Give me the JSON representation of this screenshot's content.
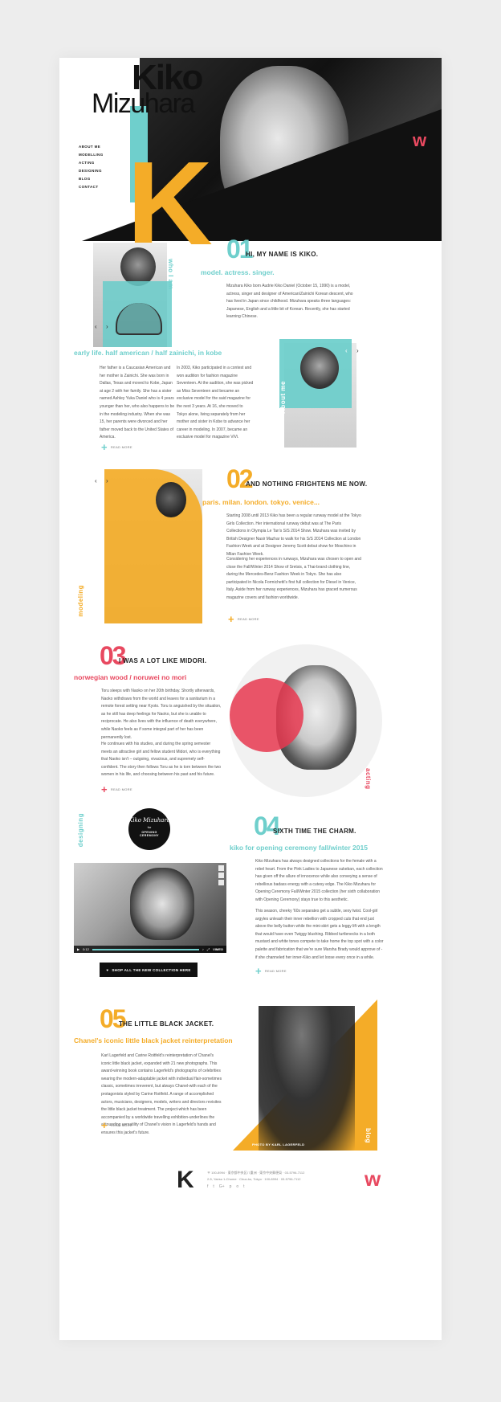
{
  "colors": {
    "teal": "#6fcfcc",
    "orange": "#f4ac28",
    "red": "#e84960",
    "dark": "#111111"
  },
  "hero": {
    "first_name": "Kiko",
    "last_name": "Mizuhara",
    "big_letter": "K",
    "logo": "w",
    "nav": [
      "ABOUT ME",
      "MODELLING",
      "ACTING",
      "DESIGNING",
      "BLOG",
      "CONTACT"
    ]
  },
  "section1": {
    "number": "01",
    "headline": "HI, MY NAME IS KIKO.",
    "subtitle": "model. actress. singer.",
    "intro": "Mizuhara Kiko born Audrie Kiko Daniel (October 15, 1990) is a model, actress, singer and designer of American/Zainichi Korean descent, who has lived in Japan since childhood. Mizuhara speaks three languages: Japanese, English and a little bit of Korean. Recently, she has started learning Chinese.",
    "side_label": "who I am",
    "early_title": "early life. half american / half zainichi, in kobe",
    "col1": "Her father is a Caucasian American and her mother is Zainichi. She was born in Dallas, Texas and moved to Kobe, Japan at age 2 with her family. She has a sister named Ashley Yuka Daniel who is 4 years younger than her, who also happens to be in the modeling industry. When she was 15, her parents were divorced and her father moved back to the United States of America.",
    "col2": "In 2003, Kiko participated in a contest and won audition for fashion magazine Seventeen. At the audition, she was picked as Miss Seventeen and became an exclusive model for the said magazine for the next 3 years. At 16, she moved to Tokyo alone, living separately from her mother and sister in Kobe to advance her career in modeling. In 2007, became an exclusive model for magazine ViVi.",
    "about_label": "About me",
    "read_more": "READ MORE"
  },
  "section2": {
    "number": "02",
    "headline": "AND NOTHING FRIGHTENS ME NOW.",
    "subtitle": "paris. milan. london. tokyo. venice...",
    "para1": "Starting 2008 until 2013 Kiko has been a regular runway model at the Tokyo Girls Collection. Her international runway debut was at The Paris Collections in Olympia Le Tan's S/S 2014 Show. Mizuhara was invited by British Designer Nasir Mazhar to walk for his S/S 2014 Collection at London Fashion Week and at Designer Jeremy Scott debut show for Moschino in Milan Fashion Week.",
    "para2": "Considering her experiences in runways, Mizuhara was chosen to open and close the Fall/Winter 2014 Show of Sretsis, a Thai-brand clothing line, during the Mercedes-Benz Fashion Week in Tokyo. She has also participated in Nicola Formichetti's first full collection for Diesel in Venice, Italy. Aside from her runway experiences, Mizuhara has graced numerous magazine covers and fashion worldwide.",
    "side_label": "modeling",
    "read_more": "READ MORE"
  },
  "section3": {
    "number": "03",
    "headline": "I WAS A LOT LIKE MIDORI.",
    "subtitle": "norwegian wood / noruwei no mori",
    "para1": "Toru sleeps with Naoko on her 20th birthday. Shortly afterwards, Naoko withdraws from the world and leaves for a sanitarium in a remote forest setting near Kyoto. Toru is anguished by the situation, as he still has deep feelings for Naoko, but she is unable to reciprocate. He also lives with the influence of death everywhere, while Naoko feels as if some integral part of her has been permanently lost.",
    "para2": "He continues with his studies, and during the spring semester meets an attractive girl and fellow student Midori, who is everything that Naoko isn't – outgoing, vivacious, and supremely self-confident. The story then follows Toru as he is torn between the two women in his life, and choosing between his past and his future.",
    "side_label": "acting",
    "read_more": "READ MORE"
  },
  "section4": {
    "number": "04",
    "headline": "SIXTH TIME THE CHARM.",
    "subtitle": "kiko for opening ceremony fall/winter 2015",
    "para1": "Kiko Mizuhara has always designed collections for the female with a rebel heart. From the Pink Ladies to Japanese sukeban, each collection has given off the allure of innocence while also conveying a sense of rebellious badass energy with a cutesy edge. The Kiko Mizuhara for Opening Ceremony Fall/Winter 2015 collection (her sixth collaboration with Opening Ceremony) stays true to this aesthetic.",
    "para2": "This season, cheeky '60s separates get a subtle, sexy twist. Cool-girl argyles unleash their inner rebellion with cropped cuts that end just above the belly button while the mini-skirt gets a leggy lift with a length that would have even Twiggy blushing. Ribbed turtlenecks in a both mustard and white tones compete to take home the top spot with a color palette and fabrication that we're sure Marsha Brady would approve of - if she channeled her inner-Kiko and let loose every once in a while.",
    "side_label": "designing",
    "badge_script": "Kiko Mizuhara",
    "badge_for": "for",
    "badge_brand": "OPENING CEREMONY",
    "shop_button": "SHOP ALL THE NEW COLLECTION HERE",
    "video_time": "0:12",
    "video_brand": "VIMEO",
    "read_more": "READ MORE"
  },
  "section5": {
    "number": "05",
    "headline": "THE LITTLE BLACK JACKET.",
    "subtitle": "Chanel's iconic little black jacket reinterpretation",
    "para1": "Karl Lagerfeld and Carine Roitfeld's reinterpretation of Chanel's iconic little black jacket, expanded with 21 new photographs. This award-winning book contains Lagerfeld's photographs of celebrities wearing the modern-adaptable jacket with individual flair-sometimes classic, sometimes irreverent, but always Chanel-with each of the protagonists styled by Carine Roitfeld. A range of accomplished actors, musicians, designers, models, writers and directors revisites the little black jacket treatment. The project-which has been accompanied by a worldwide travelling exhibition-underlines the astounding versatility of Chanel's vision in Lagerfeld's hands and ensures this jacket's future.",
    "photo_credit": "PHOTO BY KARL LAGERFELD",
    "side_label": "blog",
    "read_more": "READ MORE"
  },
  "footer": {
    "logo": "K",
    "address1": "〒 100-8994 · 東京都中央区八重洲 · 東京中央郵便局 · 03-5796-7112",
    "address2": "2-5, Yaesu 1-Chome · Chuo-ku, Tokyo · 100-8994 · 03-5796-7112",
    "social": [
      "f",
      "t",
      "G+",
      "p",
      "o",
      "t"
    ],
    "end_logo": "w"
  }
}
